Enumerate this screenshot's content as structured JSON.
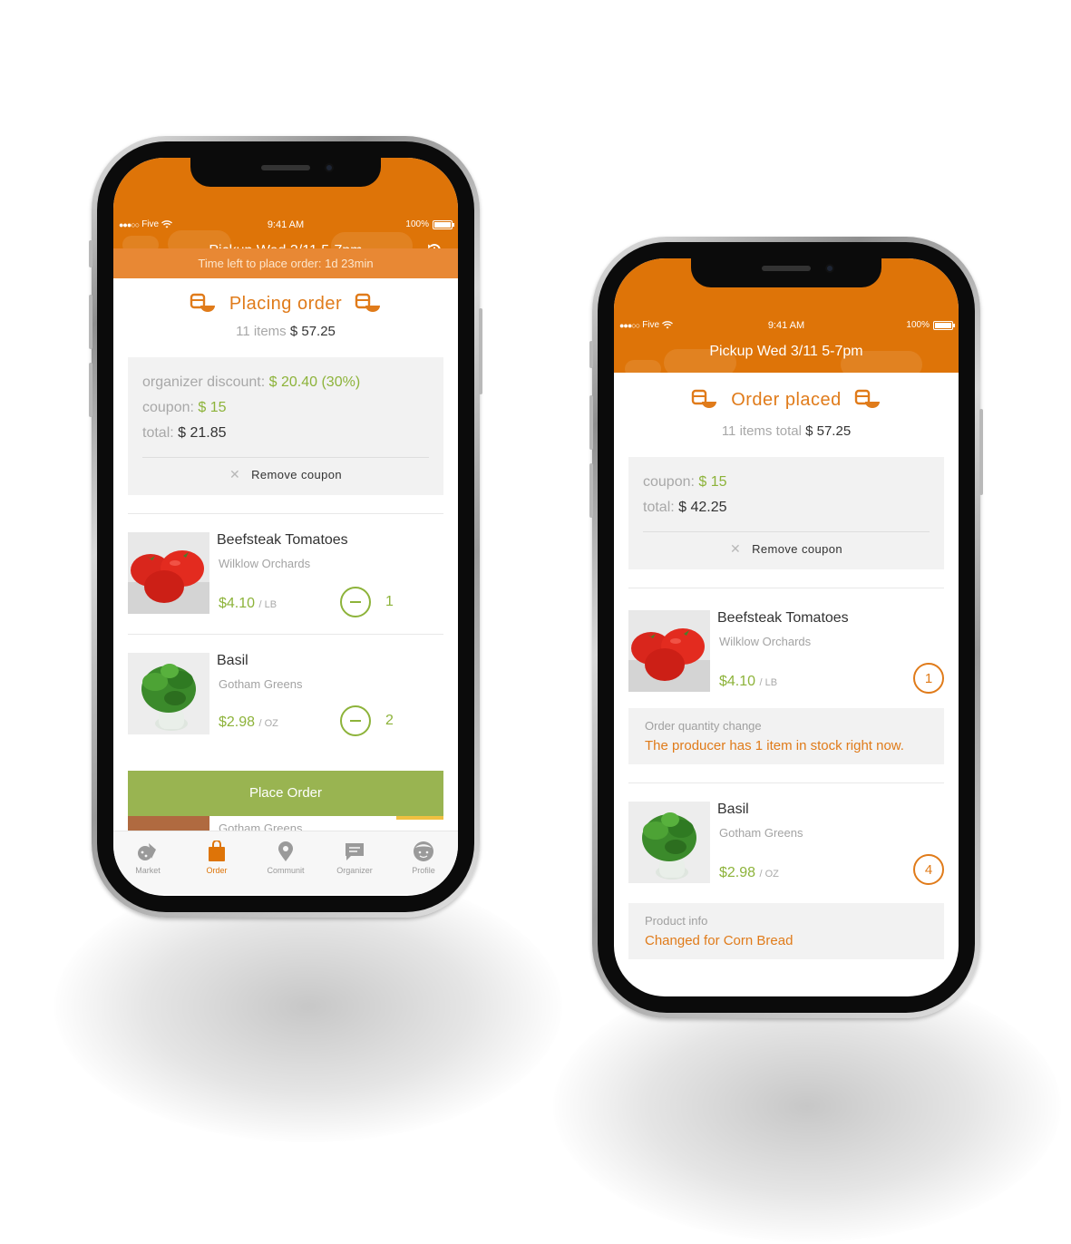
{
  "colors": {
    "brand_orange": "#de7408",
    "accent_green": "#8db33a",
    "button_green": "#99b451"
  },
  "phone1": {
    "status": {
      "carrier": "Five",
      "time": "9:41 AM",
      "battery": "100%"
    },
    "header_title": "Pickup Wed 3/11 5-7pm",
    "time_left": "Time left to place order: 1d 23min",
    "summary": {
      "title": "Placing order",
      "items_count": "11 items",
      "amount": "$ 57.25"
    },
    "discount_box": {
      "discount_label": "organizer discount:",
      "discount_value": "$ 20.40 (30%)",
      "coupon_label": "coupon:",
      "coupon_value": "$ 15",
      "total_label": "total:",
      "total_value": "$ 21.85",
      "remove_coupon": "Remove coupon"
    },
    "items": [
      {
        "name": "Beefsteak Tomatoes",
        "producer": "Wilklow Orchards",
        "price": "$4.10",
        "unit": "/ LB",
        "qty": "1"
      },
      {
        "name": "Basil",
        "producer": "Gotham Greens",
        "price": "$2.98",
        "unit": "/ OZ",
        "qty": "2"
      }
    ],
    "peek_producer": "Gotham Greens",
    "place_order": "Place Order",
    "tabs": [
      {
        "label": "Market",
        "icon": "market-icon"
      },
      {
        "label": "Order",
        "icon": "bag-icon",
        "active": true
      },
      {
        "label": "Communit",
        "icon": "location-pin-icon"
      },
      {
        "label": "Organizer",
        "icon": "chat-icon"
      },
      {
        "label": "Profile",
        "icon": "profile-icon"
      }
    ]
  },
  "phone2": {
    "status": {
      "carrier": "Five",
      "time": "9:41 AM",
      "battery": "100%"
    },
    "header_title": "Pickup Wed 3/11 5-7pm",
    "summary": {
      "title": "Order placed",
      "items_label": "11 items total",
      "amount": "$ 57.25"
    },
    "discount_box": {
      "coupon_label": "coupon:",
      "coupon_value": "$ 15",
      "total_label": "total:",
      "total_value": "$ 42.25",
      "remove_coupon": "Remove coupon"
    },
    "items": [
      {
        "name": "Beefsteak Tomatoes",
        "producer": "Wilklow Orchards",
        "price": "$4.10",
        "unit": "/ LB",
        "qty": "1",
        "notice_label": "Order quantity change",
        "notice_text": "The producer has 1 item in stock right now."
      },
      {
        "name": "Basil",
        "producer": "Gotham Greens",
        "price": "$2.98",
        "unit": "/ OZ",
        "qty": "4",
        "notice_label": "Product info",
        "notice_text": "Changed for Corn Bread"
      }
    ]
  }
}
